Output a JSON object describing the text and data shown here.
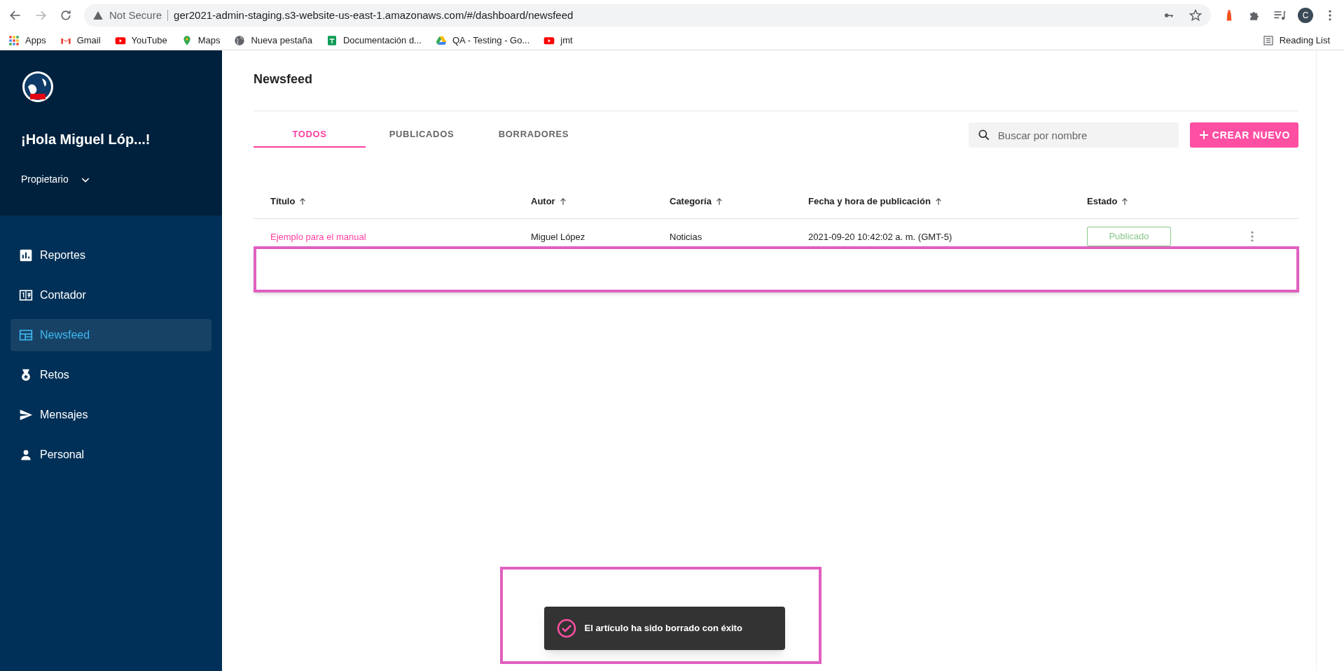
{
  "browser": {
    "security": "Not Secure",
    "url": "ger2021-admin-staging.s3-website-us-east-1.amazonaws.com/#/dashboard/newsfeed",
    "profile_initial": "C",
    "bookmarks": [
      {
        "label": "Apps",
        "kind": "apps"
      },
      {
        "label": "Gmail",
        "kind": "gmail"
      },
      {
        "label": "YouTube",
        "kind": "youtube"
      },
      {
        "label": "Maps",
        "kind": "maps"
      },
      {
        "label": "Nueva pestaña",
        "kind": "globe"
      },
      {
        "label": "Documentación d...",
        "kind": "sheets"
      },
      {
        "label": "QA - Testing - Go...",
        "kind": "drive"
      },
      {
        "label": "jmt",
        "kind": "youtube"
      }
    ],
    "reading_list": "Reading List"
  },
  "sidebar": {
    "greeting": "¡Hola Miguel Lóp...!",
    "role": "Propietario",
    "items": [
      {
        "label": "Reportes",
        "kind": "chart",
        "selected": false
      },
      {
        "label": "Contador",
        "kind": "counter",
        "selected": false
      },
      {
        "label": "Newsfeed",
        "kind": "feed",
        "selected": true
      },
      {
        "label": "Retos",
        "kind": "medal",
        "selected": false
      },
      {
        "label": "Mensajes",
        "kind": "send",
        "selected": false
      },
      {
        "label": "Personal",
        "kind": "person",
        "selected": false
      }
    ]
  },
  "page": {
    "title": "Newsfeed",
    "tabs": [
      {
        "label": "TODOS",
        "selected": true
      },
      {
        "label": "PUBLICADOS",
        "selected": false
      },
      {
        "label": "BORRADORES",
        "selected": false
      }
    ],
    "search": {
      "placeholder": "Buscar por nombre"
    },
    "create_button": "CREAR NUEVO",
    "table": {
      "columns": [
        "Título",
        "Autor",
        "Categoría",
        "Fecha y hora de publicación",
        "Estado"
      ],
      "rows": [
        {
          "title": "Ejemplo para el manual",
          "author": "Miguel López",
          "category": "Noticias",
          "date": "2021-09-20 10:42:02 a. m. (GMT-5)",
          "status": "Publicado"
        }
      ]
    }
  },
  "toast": {
    "message": "El artículo ha sido borrado con éxito"
  }
}
